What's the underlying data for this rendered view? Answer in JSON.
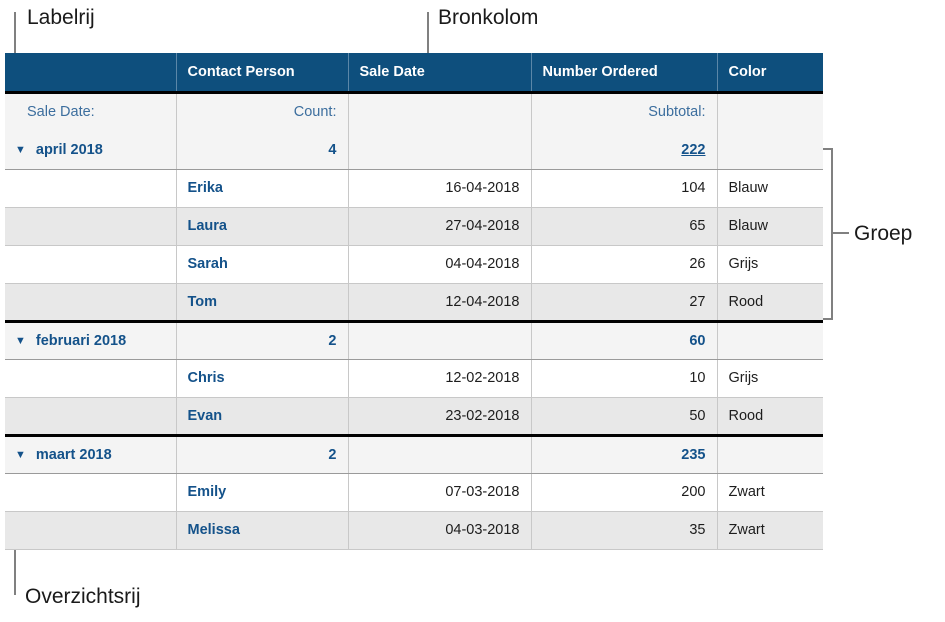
{
  "annotations": {
    "label_row": "Labelrij",
    "source_column": "Bronkolom",
    "group": "Groep",
    "summary_row": "Overzichtsrij"
  },
  "table": {
    "headers": [
      "",
      "Contact Person",
      "Sale Date",
      "Number Ordered",
      "Color"
    ],
    "label_row": {
      "field_label": "Sale Date:",
      "count_label": "Count:",
      "date_label": "",
      "subtotal_label": "Subtotal:",
      "color_label": ""
    },
    "groups": [
      {
        "name": "april 2018",
        "disclosure": "triangle-down-icon",
        "count": "4",
        "subtotal": "222",
        "subtotal_underlined": true,
        "rows": [
          {
            "person": "Erika",
            "date": "16-04-2018",
            "number": "104",
            "color": "Blauw"
          },
          {
            "person": "Laura",
            "date": "27-04-2018",
            "number": "65",
            "color": "Blauw"
          },
          {
            "person": "Sarah",
            "date": "04-04-2018",
            "number": "26",
            "color": "Grijs"
          },
          {
            "person": "Tom",
            "date": "12-04-2018",
            "number": "27",
            "color": "Rood"
          }
        ]
      },
      {
        "name": "februari 2018",
        "disclosure": "triangle-down-icon",
        "count": "2",
        "subtotal": "60",
        "subtotal_underlined": false,
        "rows": [
          {
            "person": "Chris",
            "date": "12-02-2018",
            "number": "10",
            "color": "Grijs"
          },
          {
            "person": "Evan",
            "date": "23-02-2018",
            "number": "50",
            "color": "Rood"
          }
        ]
      },
      {
        "name": "maart 2018",
        "disclosure": "triangle-down-icon",
        "count": "2",
        "subtotal": "235",
        "subtotal_underlined": false,
        "rows": [
          {
            "person": "Emily",
            "date": "07-03-2018",
            "number": "200",
            "color": "Zwart"
          },
          {
            "person": "Melissa",
            "date": "04-03-2018",
            "number": "35",
            "color": "Zwart"
          }
        ]
      }
    ]
  },
  "colors": {
    "header_background": "#0E4F7D",
    "header_text": "#FFFFFF",
    "accent_blue": "#14528A",
    "label_blue": "#3C6E9E",
    "group_row_background": "#F4F4F4",
    "stripe_background": "#E8E8E8",
    "row_background": "#FFFFFF",
    "callout_line": "#808080",
    "heavy_rule": "#000000"
  }
}
